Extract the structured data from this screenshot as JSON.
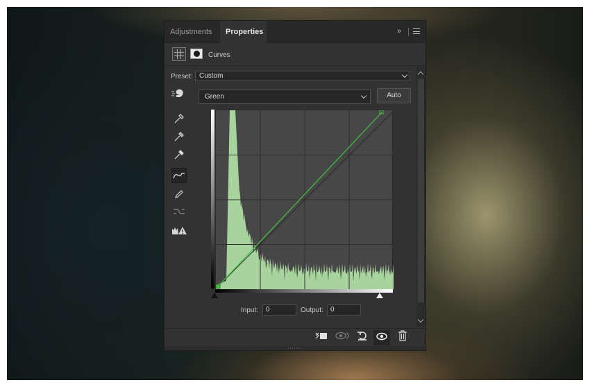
{
  "panel": {
    "tabs": [
      {
        "label": "Adjustments",
        "active": false
      },
      {
        "label": "Properties",
        "active": true
      }
    ]
  },
  "header": {
    "title": "Curves"
  },
  "preset": {
    "label": "Preset:",
    "value": "Custom"
  },
  "channel": {
    "value": "Green",
    "auto_label": "Auto"
  },
  "tools": [
    "hand-target-icon",
    "black-point-eyedropper-icon",
    "gray-point-eyedropper-icon",
    "white-point-eyedropper-icon",
    "curve-edit-icon",
    "pencil-icon",
    "smooth-curve-icon",
    "clipping-warning-icon"
  ],
  "curve": {
    "color": "#3fc43f",
    "histogram_color": "#a7d49c",
    "input_min": 0,
    "input_max": 255,
    "output_min": 0,
    "output_max": 255,
    "points": [
      [
        0,
        0
      ],
      [
        255,
        255
      ]
    ]
  },
  "io": {
    "input_label": "Input:",
    "input_value": "0",
    "output_label": "Output:",
    "output_value": "0"
  },
  "footer": {
    "buttons": [
      "clip-to-layer-icon",
      "view-previous-icon",
      "reset-icon",
      "visibility-icon",
      "trash-icon"
    ]
  }
}
